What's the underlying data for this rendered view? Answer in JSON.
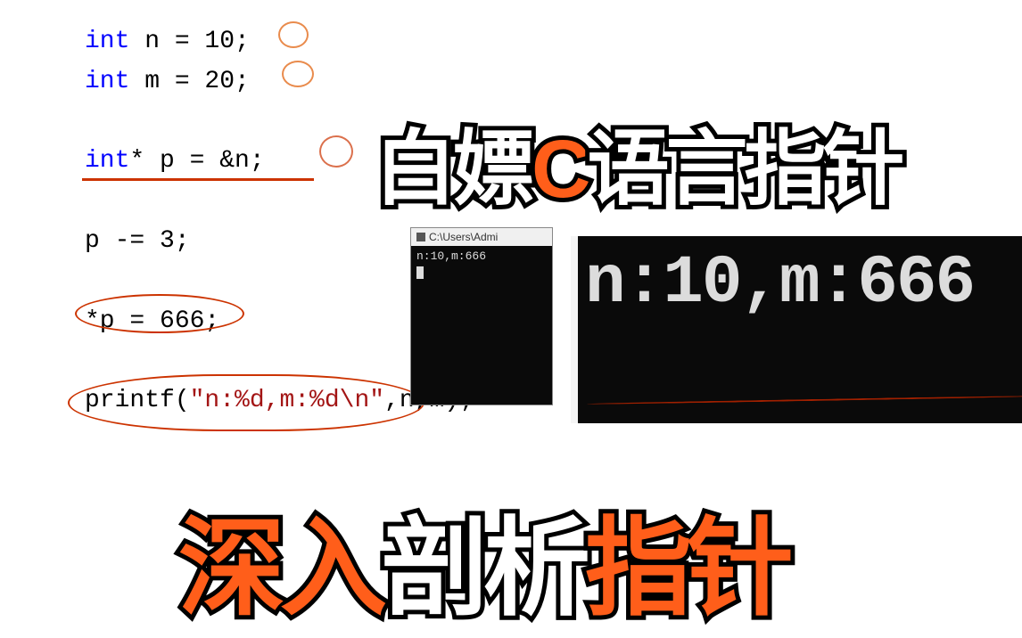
{
  "code": {
    "line1_kw": "int",
    "line1_rest": " n = 10;",
    "line2_kw": "int",
    "line2_rest": " m = 20;",
    "line3_kw": "int",
    "line3_rest": "* p = &n;",
    "line4": "p -= 3;",
    "line5": "*p = 666;",
    "line6_print": "printf(",
    "line6_str": "\"n:%d,m:%d\\n\"",
    "line6_rest": ",n,m);"
  },
  "headline_top": {
    "p1": "白嫖",
    "p2": "C",
    "p3": "语言指针"
  },
  "headline_bottom": {
    "p1": "深入",
    "p2": "剖析",
    "p3": "指针"
  },
  "console_small": {
    "title": "C:\\Users\\Admi",
    "output": "n:10,m:666"
  },
  "console_big": {
    "output": "n:10,m:666"
  }
}
